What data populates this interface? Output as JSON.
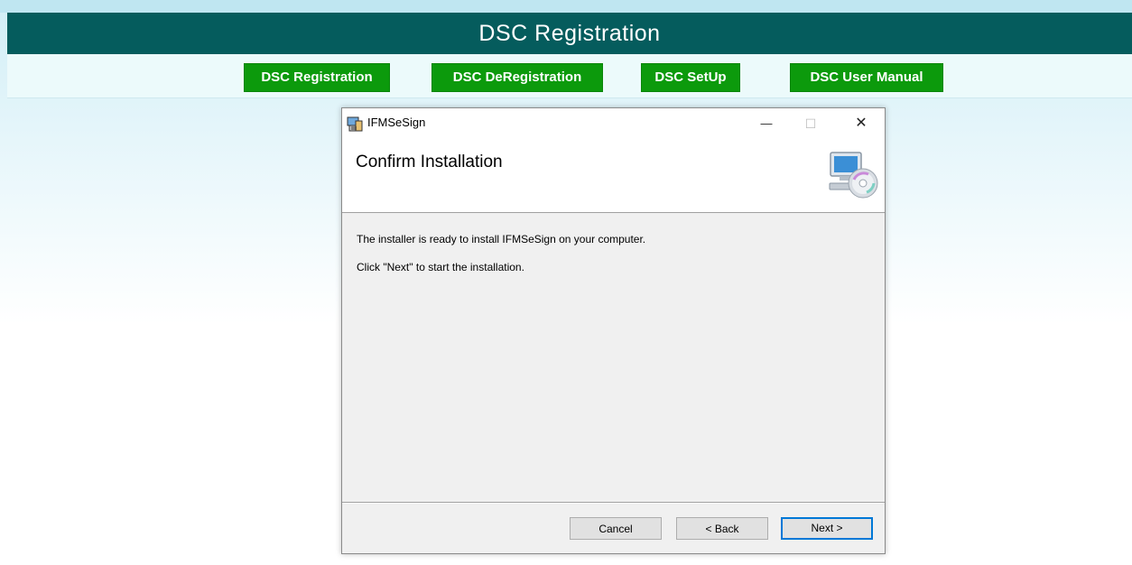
{
  "header": {
    "title": "DSC Registration"
  },
  "nav": {
    "items": [
      {
        "label": "DSC Registration"
      },
      {
        "label": "DSC DeRegistration"
      },
      {
        "label": "DSC SetUp"
      },
      {
        "label": "DSC User Manual"
      }
    ]
  },
  "dialog": {
    "title": "IFMSeSign",
    "heading": "Confirm Installation",
    "message_1": "The installer is ready to install IFMSeSign on your computer.",
    "message_2": "Click \"Next\" to start the installation.",
    "buttons": {
      "cancel": "Cancel",
      "back": "< Back",
      "next": "Next >"
    },
    "window_controls": {
      "minimize": "—",
      "maximize": "☐",
      "close": "✕"
    },
    "icons": {
      "app": "installer-icon",
      "banner": "computer-cd-icon"
    }
  },
  "colors": {
    "header_bg": "#055c5d",
    "nav_button_bg": "#0c9a0c",
    "primary_button_border": "#0078d7"
  }
}
